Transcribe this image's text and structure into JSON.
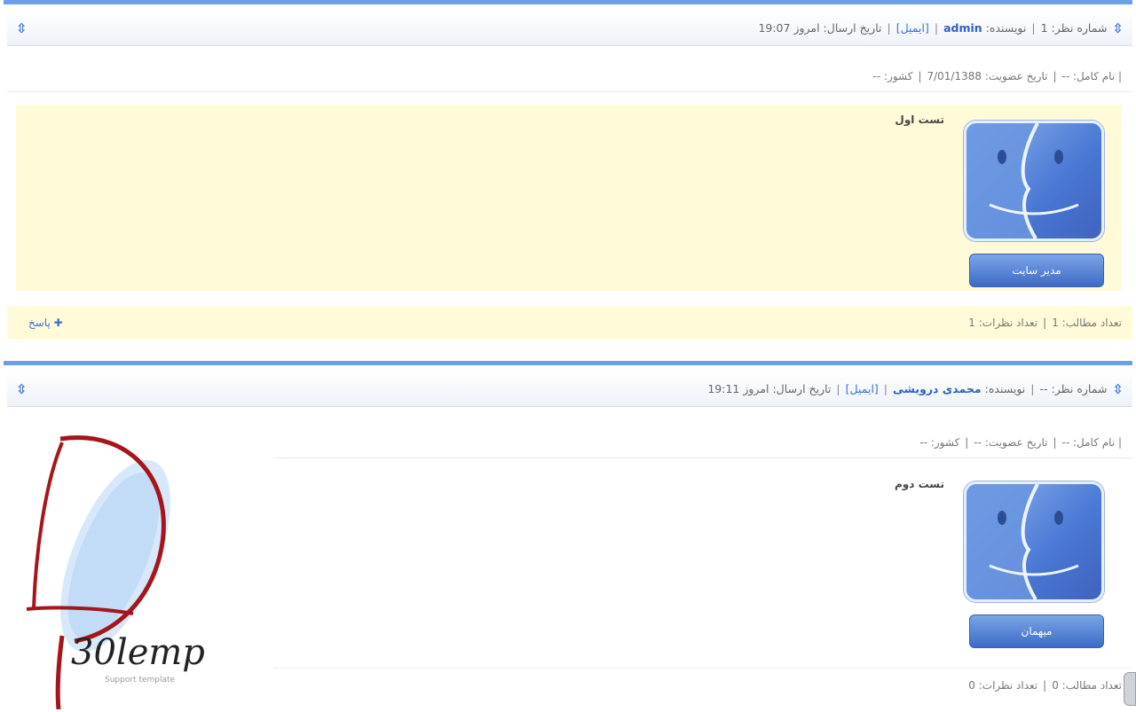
{
  "comments": [
    {
      "header": {
        "number_label": "شماره نظر: 1",
        "author_prefix": "نویسنده:",
        "author": "admin",
        "email": "[ایمیل]",
        "date": "تاریخ ارسال: امروز 19:07"
      },
      "info": {
        "fullname": "| نام کامل: --",
        "joined": "تاریخ عضویت: 7/01/1388",
        "country": "کشور: --"
      },
      "text": "تست اول",
      "role": "مدیر سایت",
      "footer": {
        "posts": "تعداد مطالب: 1",
        "comments": "تعداد نظرات: 1"
      },
      "reply": "پاسخ"
    },
    {
      "header": {
        "number_label": "شماره نظر: --",
        "author_prefix": "نویسنده:",
        "author": "محمدی درویشی",
        "email": "[ایمیل]",
        "date": "تاریخ ارسال: امروز 19:11"
      },
      "info": {
        "fullname": "| نام کامل: --",
        "joined": "تاریخ عضویت: --",
        "country": "کشور: --"
      },
      "text": "تست دوم",
      "role": "میهمان",
      "footer": {
        "posts": "تعداد مطالب: 0",
        "comments": "تعداد نظرات: 0"
      }
    }
  ],
  "logo": {
    "text": "30lemp",
    "subtext": "Support template"
  },
  "colors": {
    "accent": "#3d6fd6",
    "post_background": "#fffbd8",
    "top_bar": "#6f9ee8"
  },
  "icons": {
    "header_icon": "double-chevron-icon",
    "avatar": "finder-face-icon"
  }
}
